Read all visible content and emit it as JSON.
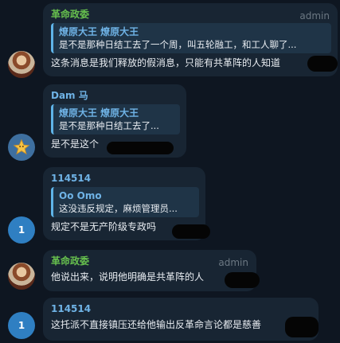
{
  "messages": [
    {
      "sender": "革命政委",
      "role": "admin",
      "reply_name": "燎原大王 燎原大王",
      "reply_text": "是不是那种日结工去了一个周，叫五轮融工，和工人聊了...",
      "text": "这条消息是我们释放的假消息，只能有共革阵的人知道",
      "avatar_icon": "user-photo"
    },
    {
      "sender": "Dam 马",
      "reply_name": "燎原大王 燎原大王",
      "reply_text": "是不是那种日结工去了...",
      "text": "是不是这个",
      "avatar_icon": "star-icon"
    },
    {
      "sender": "114514",
      "reply_name": "Oo Omo",
      "reply_text": "这没违反规定，麻烦管理员...",
      "text": "规定不是无产阶级专政吗",
      "avatar_icon": "1"
    },
    {
      "sender": "革命政委",
      "role": "admin",
      "text": "他说出来，说明他明确是共革阵的人",
      "avatar_icon": "user-photo"
    },
    {
      "sender": "114514",
      "text": "这托派不直接镇压还给他输出反革命言论都是慈善",
      "avatar_icon": "1"
    }
  ],
  "colors": {
    "background": "#0e1621",
    "bubble": "#182533",
    "admin_name": "#67c04e",
    "member_name": "#6fb3e6",
    "reply_bar": "#5fb4e8"
  }
}
